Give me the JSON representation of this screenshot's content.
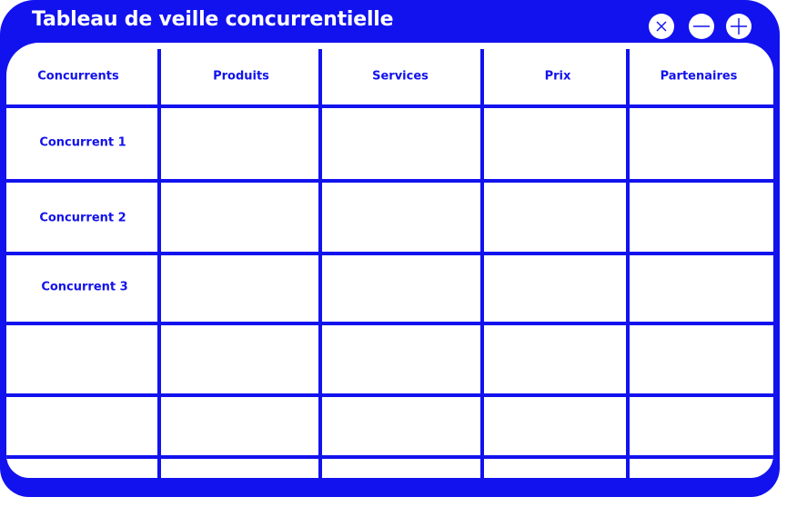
{
  "window": {
    "title": "Tableau de veille concurrentielle",
    "controls": [
      {
        "name": "close",
        "icon": "close-icon"
      },
      {
        "name": "minimize",
        "icon": "minus-icon"
      },
      {
        "name": "maximize",
        "icon": "plus-icon"
      }
    ]
  },
  "colors": {
    "accent": "#1212ee",
    "background": "#ffffff"
  },
  "table": {
    "headers": [
      "Concurrents",
      "Produits",
      "Services",
      "Prix",
      "Partenaires"
    ],
    "rows": [
      {
        "label": "Concurrent 1",
        "cells": [
          "",
          "",
          "",
          ""
        ]
      },
      {
        "label": "Concurrent 2",
        "cells": [
          "",
          "",
          "",
          ""
        ]
      },
      {
        "label": "Concurrent 3",
        "cells": [
          "",
          "",
          "",
          ""
        ]
      },
      {
        "label": "",
        "cells": [
          "",
          "",
          "",
          ""
        ]
      },
      {
        "label": "",
        "cells": [
          "",
          "",
          "",
          ""
        ]
      },
      {
        "label": "",
        "cells": [
          "",
          "",
          "",
          ""
        ]
      }
    ]
  }
}
